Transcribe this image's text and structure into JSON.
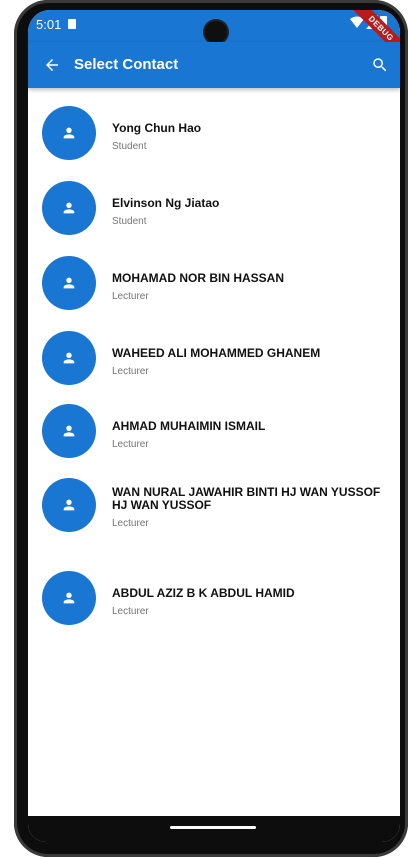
{
  "status_bar": {
    "time": "5:01"
  },
  "debug_banner": "DEBUG",
  "app_bar": {
    "title": "Select Contact",
    "back_icon": "arrow-back-icon",
    "search_icon": "search-icon"
  },
  "colors": {
    "primary": "#1976D2",
    "secondary_text": "#757575"
  },
  "contacts": [
    {
      "name": "Yong Chun Hao",
      "role": "Student",
      "icon": "person-icon"
    },
    {
      "name": "Elvinson Ng Jiatao",
      "role": "Student",
      "icon": "person-icon"
    },
    {
      "name": "MOHAMAD NOR BIN HASSAN",
      "role": "Lecturer",
      "icon": "person-icon"
    },
    {
      "name": "WAHEED ALI MOHAMMED GHANEM",
      "role": "Lecturer",
      "icon": "person-icon"
    },
    {
      "name": "AHMAD MUHAIMIN ISMAIL",
      "role": "Lecturer",
      "icon": "person-icon"
    },
    {
      "name": "WAN NURAL JAWAHIR BINTI HJ WAN YUSSOF HJ WAN YUSSOF",
      "role": "Lecturer",
      "icon": "person-icon"
    },
    {
      "name": "ABDUL AZIZ B K ABDUL HAMID",
      "role": "Lecturer",
      "icon": "person-icon"
    }
  ]
}
